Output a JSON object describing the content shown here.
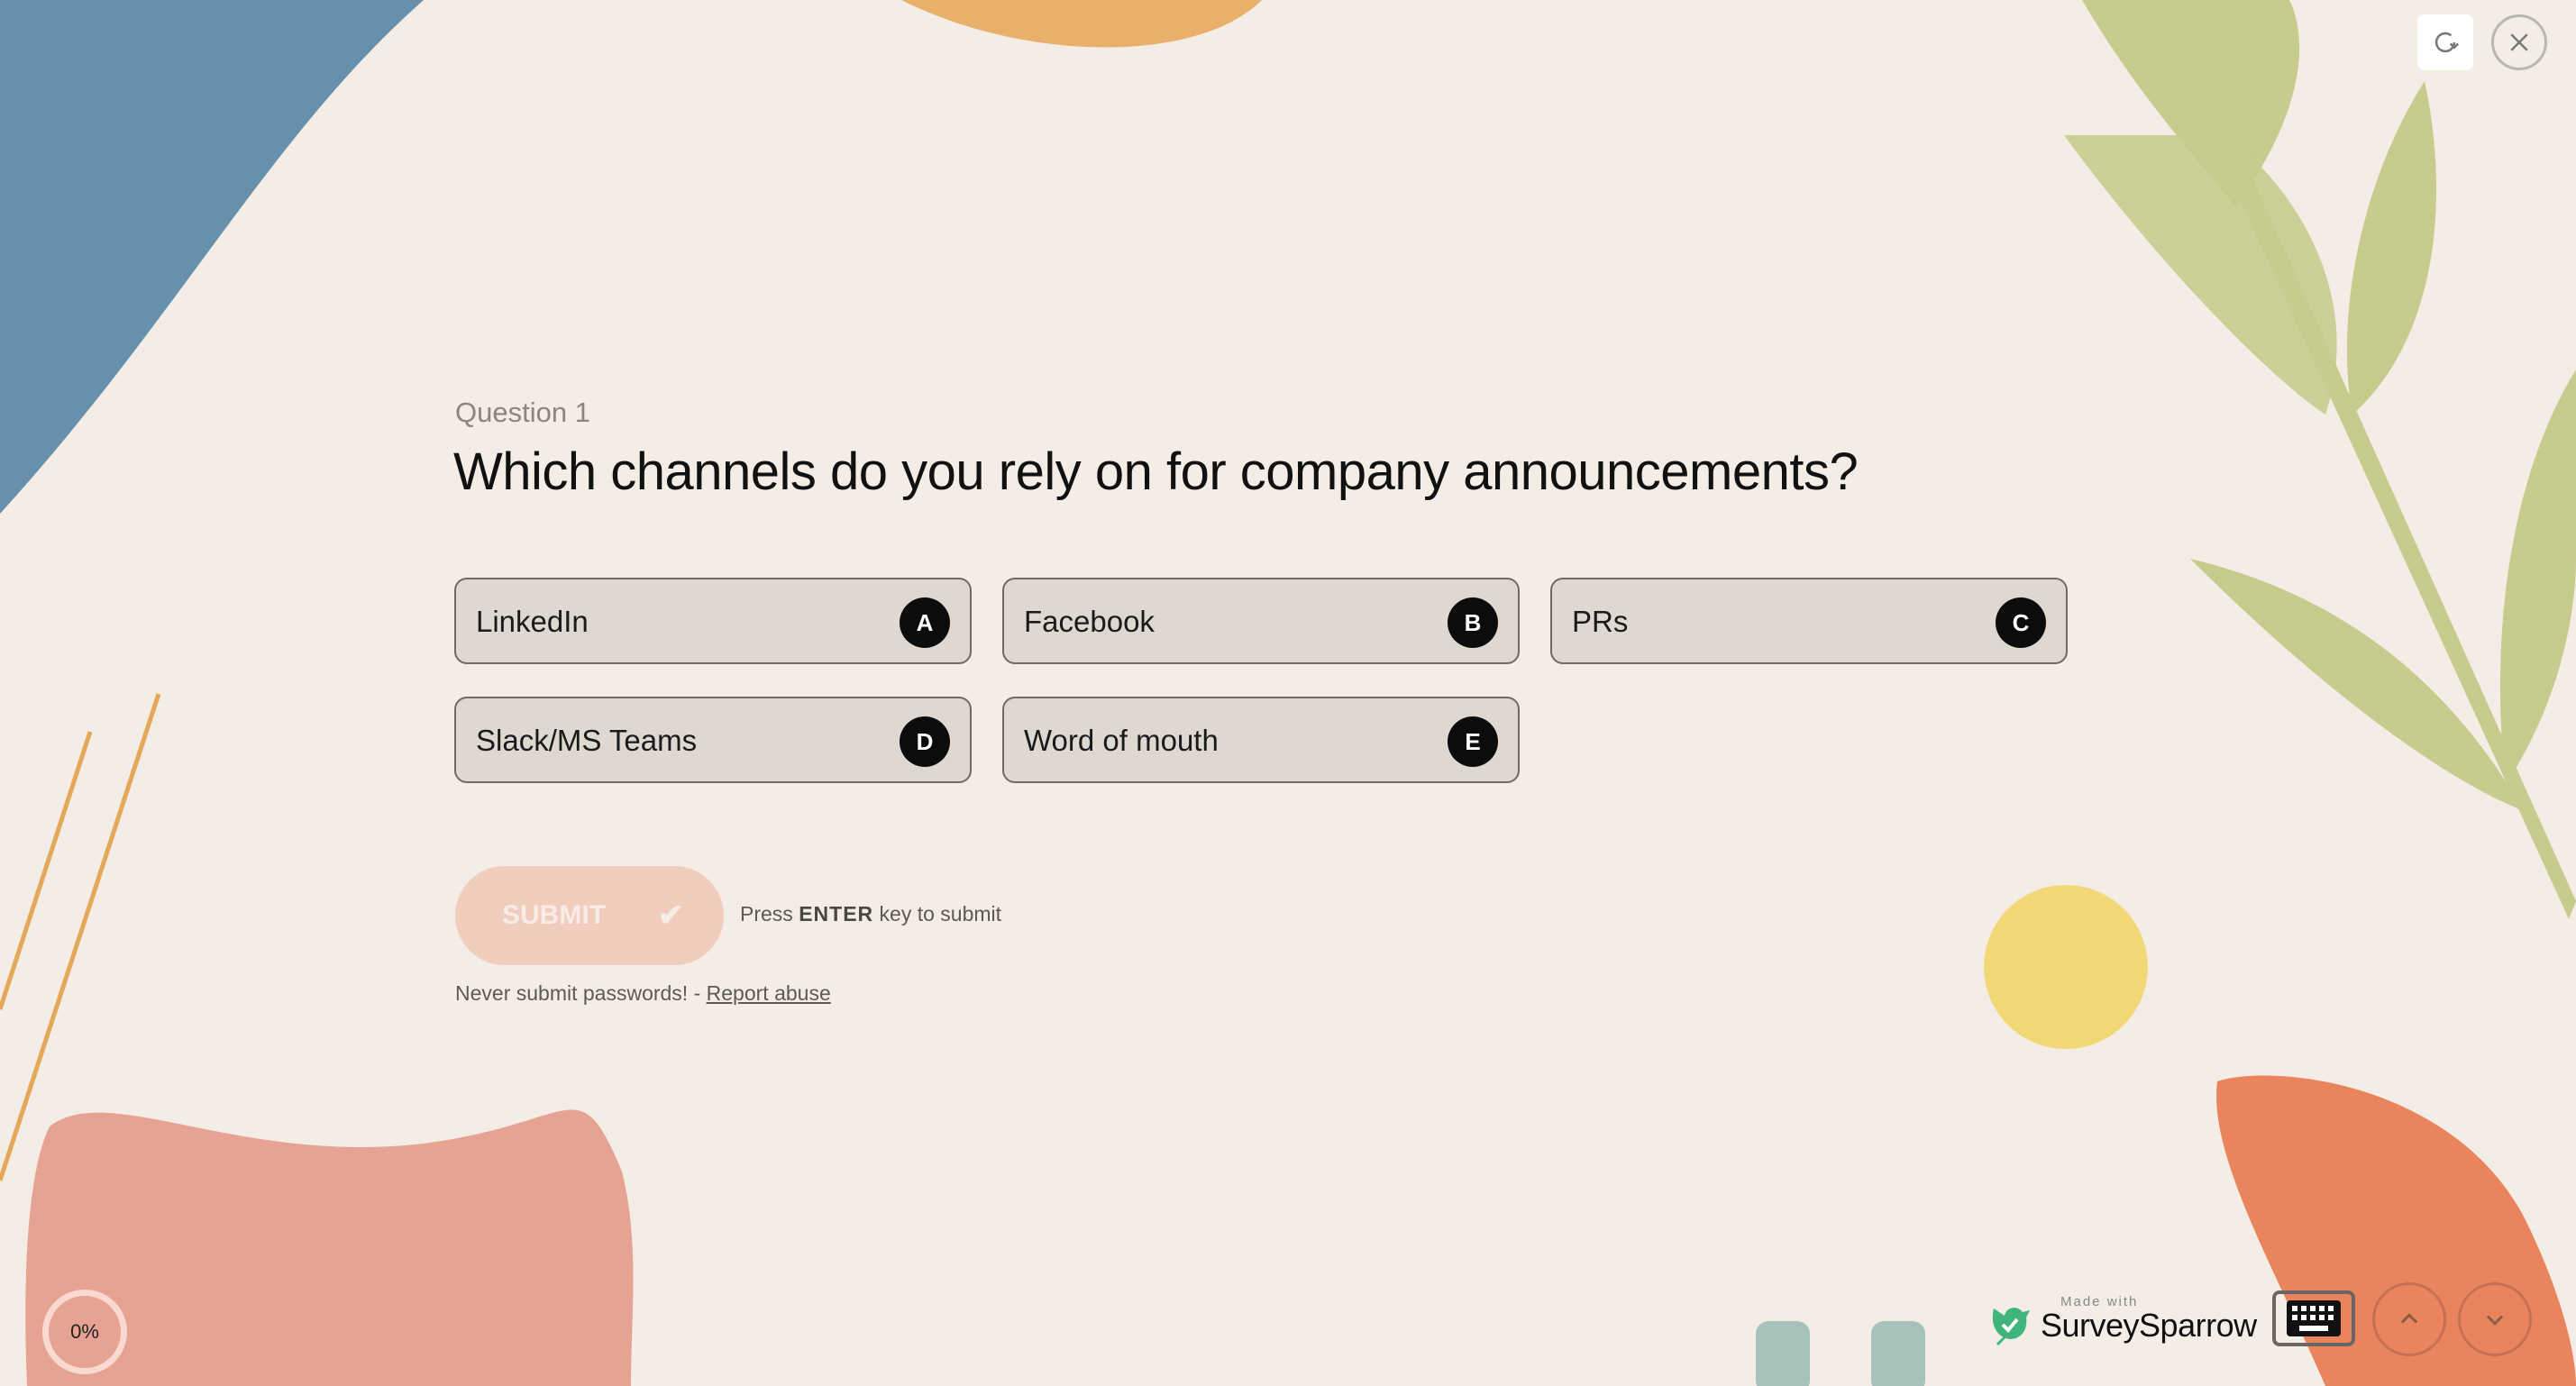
{
  "question": {
    "number_label": "Question 1",
    "title": "Which channels do you rely on for company announcements?"
  },
  "options": [
    {
      "label": "LinkedIn",
      "key": "A"
    },
    {
      "label": "Facebook",
      "key": "B"
    },
    {
      "label": "PRs",
      "key": "C"
    },
    {
      "label": "Slack/MS Teams",
      "key": "D"
    },
    {
      "label": "Word of mouth",
      "key": "E"
    }
  ],
  "submit": {
    "label": "SUBMIT",
    "check_icon": "check-icon",
    "hint_prefix": "Press ",
    "hint_key": "ENTER",
    "hint_suffix": " key to submit"
  },
  "footer_note": {
    "text": "Never submit passwords! - ",
    "link": "Report abuse"
  },
  "progress": {
    "label": "0%",
    "value": 0
  },
  "branding": {
    "made_with": "Made with",
    "name": "SurveySparrow",
    "accent": "#3fb57c"
  },
  "top_controls": {
    "refresh_icon": "refresh-icon",
    "close_icon": "close-icon"
  },
  "colors": {
    "background": "#f3ede6",
    "blue_shape": "#6690ab",
    "orange_top": "#e8b06a",
    "green_leaves": "#c6c98a",
    "pink_shape": "#e6a293",
    "orange_shape": "#e9825a",
    "yellow_circle": "#f3d877",
    "submit_bg": "#f0cdbd"
  }
}
